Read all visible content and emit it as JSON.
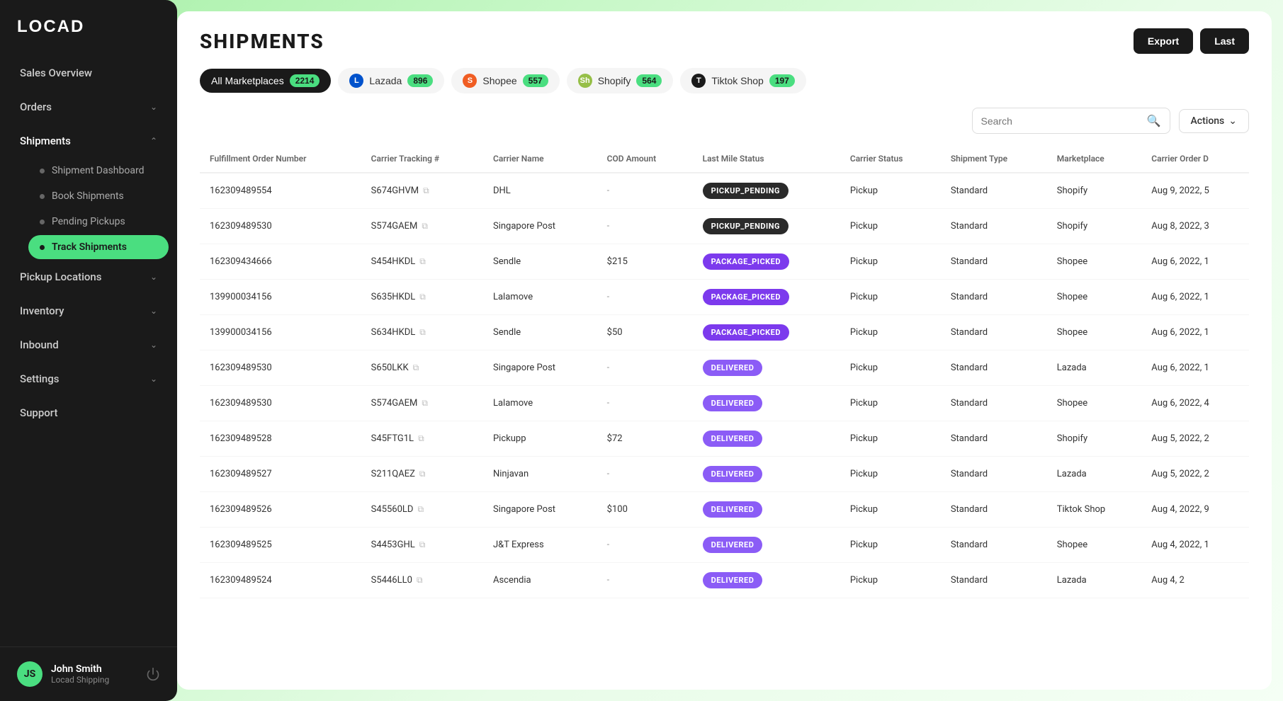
{
  "logo": "LOCAD",
  "sidebar": {
    "nav_items": [
      {
        "id": "sales-overview",
        "label": "Sales Overview",
        "expandable": false
      },
      {
        "id": "orders",
        "label": "Orders",
        "expandable": true
      },
      {
        "id": "shipments",
        "label": "Shipments",
        "expandable": true,
        "expanded": true,
        "sub_items": [
          {
            "id": "shipment-dashboard",
            "label": "Shipment Dashboard",
            "active": false
          },
          {
            "id": "book-shipments",
            "label": "Book Shipments",
            "active": false
          },
          {
            "id": "pending-pickups",
            "label": "Pending Pickups",
            "active": false
          },
          {
            "id": "track-shipments",
            "label": "Track Shipments",
            "active": true
          }
        ]
      },
      {
        "id": "pickup-locations",
        "label": "Pickup Locations",
        "expandable": true
      },
      {
        "id": "inventory",
        "label": "Inventory",
        "expandable": true
      },
      {
        "id": "inbound",
        "label": "Inbound",
        "expandable": true
      },
      {
        "id": "settings",
        "label": "Settings",
        "expandable": true
      },
      {
        "id": "support",
        "label": "Support",
        "expandable": false
      }
    ],
    "user": {
      "name": "John Smith",
      "company": "Locad Shipping",
      "initials": "JS"
    }
  },
  "header": {
    "title": "SHIPMENTS",
    "export_label": "Export",
    "last_label": "Last"
  },
  "marketplaces": [
    {
      "id": "all",
      "label": "All Marketplaces",
      "count": "2214",
      "active": true,
      "icon_type": "all"
    },
    {
      "id": "lazada",
      "label": "Lazada",
      "count": "896",
      "active": false,
      "icon_type": "lazada",
      "icon_text": "L"
    },
    {
      "id": "shopee",
      "label": "Shopee",
      "count": "557",
      "active": false,
      "icon_type": "shopee",
      "icon_text": "S"
    },
    {
      "id": "shopify",
      "label": "Shopify",
      "count": "564",
      "active": false,
      "icon_type": "shopify",
      "icon_text": "Sh"
    },
    {
      "id": "tiktok",
      "label": "Tiktok Shop",
      "count": "197",
      "active": false,
      "icon_type": "tiktok",
      "icon_text": "T"
    }
  ],
  "search": {
    "placeholder": "Search"
  },
  "actions_label": "Actions",
  "table": {
    "columns": [
      "Fulfillment Order Number",
      "Carrier Tracking #",
      "Carrier Name",
      "COD Amount",
      "Last Mile Status",
      "Carrier Status",
      "Shipment Type",
      "Marketplace",
      "Carrier Order D"
    ],
    "rows": [
      {
        "fulfillment_order": "162309489554",
        "carrier_tracking": "S674GHVM",
        "carrier_name": "DHL",
        "cod_amount": "-",
        "last_mile_status": "PICKUP_PENDING",
        "last_mile_status_type": "pickup-pending",
        "carrier_status": "Pickup",
        "shipment_type": "Standard",
        "marketplace": "Shopify",
        "carrier_order_date": "Aug 9, 2022, 5"
      },
      {
        "fulfillment_order": "162309489530",
        "carrier_tracking": "S574GAEM",
        "carrier_name": "Singapore Post",
        "cod_amount": "-",
        "last_mile_status": "PICKUP_PENDING",
        "last_mile_status_type": "pickup-pending",
        "carrier_status": "Pickup",
        "shipment_type": "Standard",
        "marketplace": "Shopify",
        "carrier_order_date": "Aug 8, 2022, 3"
      },
      {
        "fulfillment_order": "162309434666",
        "carrier_tracking": "S454HKDL",
        "carrier_name": "Sendle",
        "cod_amount": "$215",
        "last_mile_status": "PACKAGE_PICKED",
        "last_mile_status_type": "package-picked",
        "carrier_status": "Pickup",
        "shipment_type": "Standard",
        "marketplace": "Shopee",
        "carrier_order_date": "Aug 6, 2022, 1"
      },
      {
        "fulfillment_order": "139900034156",
        "carrier_tracking": "S635HKDL",
        "carrier_name": "Lalamove",
        "cod_amount": "-",
        "last_mile_status": "PACKAGE_PICKED",
        "last_mile_status_type": "package-picked",
        "carrier_status": "Pickup",
        "shipment_type": "Standard",
        "marketplace": "Shopee",
        "carrier_order_date": "Aug 6, 2022, 1"
      },
      {
        "fulfillment_order": "139900034156",
        "carrier_tracking": "S634HKDL",
        "carrier_name": "Sendle",
        "cod_amount": "$50",
        "last_mile_status": "PACKAGE_PICKED",
        "last_mile_status_type": "package-picked",
        "carrier_status": "Pickup",
        "shipment_type": "Standard",
        "marketplace": "Shopee",
        "carrier_order_date": "Aug 6, 2022, 1"
      },
      {
        "fulfillment_order": "162309489530",
        "carrier_tracking": "S650LKK",
        "carrier_name": "Singapore Post",
        "cod_amount": "-",
        "last_mile_status": "DELIVERED",
        "last_mile_status_type": "delivered",
        "carrier_status": "Pickup",
        "shipment_type": "Standard",
        "marketplace": "Lazada",
        "carrier_order_date": "Aug 6, 2022, 1"
      },
      {
        "fulfillment_order": "162309489530",
        "carrier_tracking": "S574GAEM",
        "carrier_name": "Lalamove",
        "cod_amount": "-",
        "last_mile_status": "DELIVERED",
        "last_mile_status_type": "delivered",
        "carrier_status": "Pickup",
        "shipment_type": "Standard",
        "marketplace": "Shopee",
        "carrier_order_date": "Aug 6, 2022, 4"
      },
      {
        "fulfillment_order": "162309489528",
        "carrier_tracking": "S45FTG1L",
        "carrier_name": "Pickupp",
        "cod_amount": "$72",
        "last_mile_status": "DELIVERED",
        "last_mile_status_type": "delivered",
        "carrier_status": "Pickup",
        "shipment_type": "Standard",
        "marketplace": "Shopify",
        "carrier_order_date": "Aug 5, 2022, 2"
      },
      {
        "fulfillment_order": "162309489527",
        "carrier_tracking": "S211QAEZ",
        "carrier_name": "Ninjavan",
        "cod_amount": "-",
        "last_mile_status": "DELIVERED",
        "last_mile_status_type": "delivered",
        "carrier_status": "Pickup",
        "shipment_type": "Standard",
        "marketplace": "Lazada",
        "carrier_order_date": "Aug 5, 2022, 2"
      },
      {
        "fulfillment_order": "162309489526",
        "carrier_tracking": "S45560LD",
        "carrier_name": "Singapore Post",
        "cod_amount": "$100",
        "last_mile_status": "DELIVERED",
        "last_mile_status_type": "delivered",
        "carrier_status": "Pickup",
        "shipment_type": "Standard",
        "marketplace": "Tiktok Shop",
        "carrier_order_date": "Aug 4, 2022, 9"
      },
      {
        "fulfillment_order": "162309489525",
        "carrier_tracking": "S4453GHL",
        "carrier_name": "J&T Express",
        "cod_amount": "-",
        "last_mile_status": "DELIVERED",
        "last_mile_status_type": "delivered",
        "carrier_status": "Pickup",
        "shipment_type": "Standard",
        "marketplace": "Shopee",
        "carrier_order_date": "Aug 4, 2022, 1"
      },
      {
        "fulfillment_order": "162309489524",
        "carrier_tracking": "S5446LL0",
        "carrier_name": "Ascendia",
        "cod_amount": "-",
        "last_mile_status": "DELIVERED",
        "last_mile_status_type": "delivered",
        "carrier_status": "Pickup",
        "shipment_type": "Standard",
        "marketplace": "Lazada",
        "carrier_order_date": "Aug 4, 2"
      }
    ]
  }
}
